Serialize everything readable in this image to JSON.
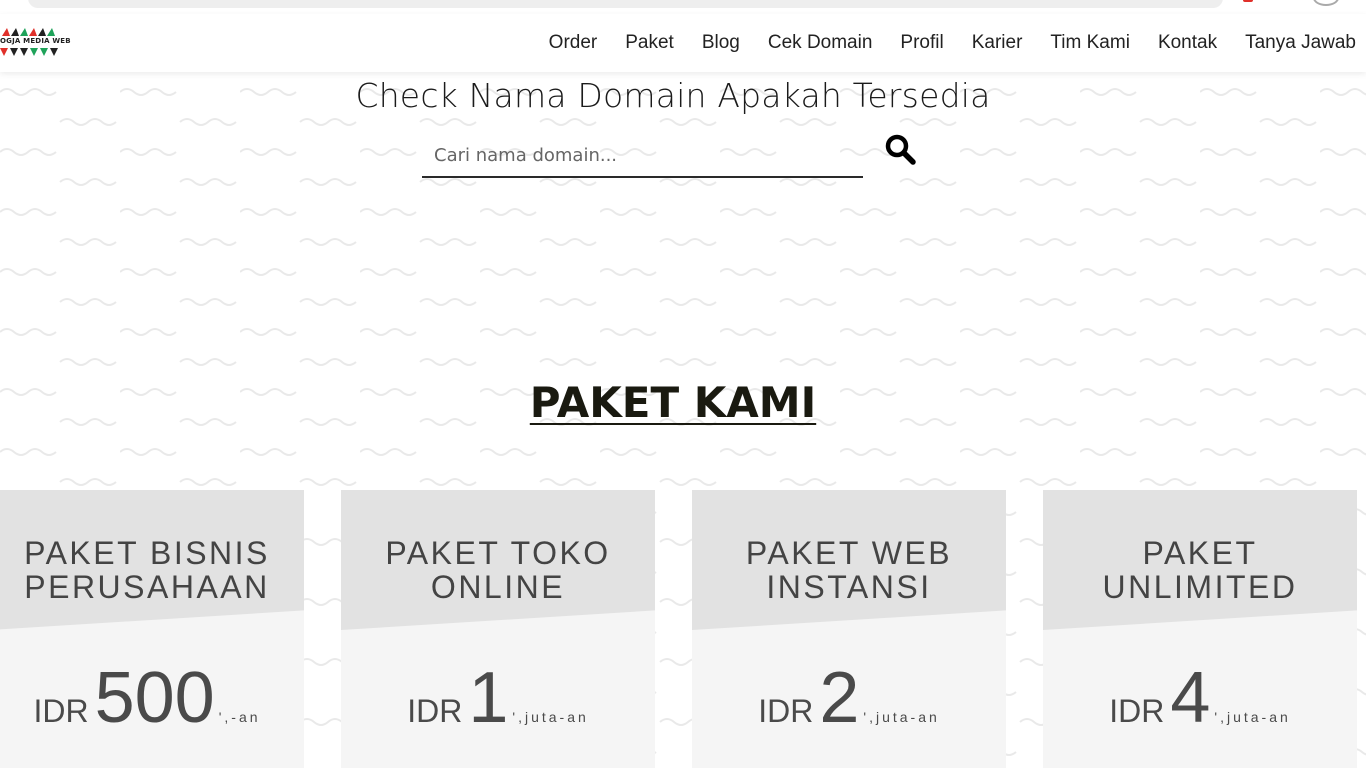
{
  "logo": {
    "text": "OGJA MEDIA WEB"
  },
  "nav": {
    "items": [
      "Order",
      "Paket",
      "Blog",
      "Cek Domain",
      "Profil",
      "Karier",
      "Tim Kami",
      "Kontak",
      "Tanya Jawab"
    ]
  },
  "domain_search": {
    "title": "Check Nama Domain Apakah Tersedia",
    "placeholder": "Cari nama domain...",
    "value": "",
    "button_icon": "search-icon"
  },
  "packages": {
    "title": "PAKET KAMI",
    "items": [
      {
        "name_line1": "PAKET BISNIS",
        "name_line2": "PERUSAHAAN",
        "currency": "IDR",
        "amount": "500",
        "suffix": "',-an"
      },
      {
        "name_line1": "PAKET TOKO",
        "name_line2": "ONLINE",
        "currency": "IDR",
        "amount": "1",
        "suffix": "',juta-an"
      },
      {
        "name_line1": "PAKET WEB",
        "name_line2": "INSTANSI",
        "currency": "IDR",
        "amount": "2",
        "suffix": "',juta-an"
      },
      {
        "name_line1": "PAKET",
        "name_line2": "UNLIMITED",
        "currency": "IDR",
        "amount": "4",
        "suffix": "',juta-an"
      }
    ]
  },
  "colors": {
    "card_header": "#e2e2e2",
    "card_body": "#f5f5f5",
    "logo_red": "#e0302a",
    "logo_green": "#1fa35a"
  }
}
